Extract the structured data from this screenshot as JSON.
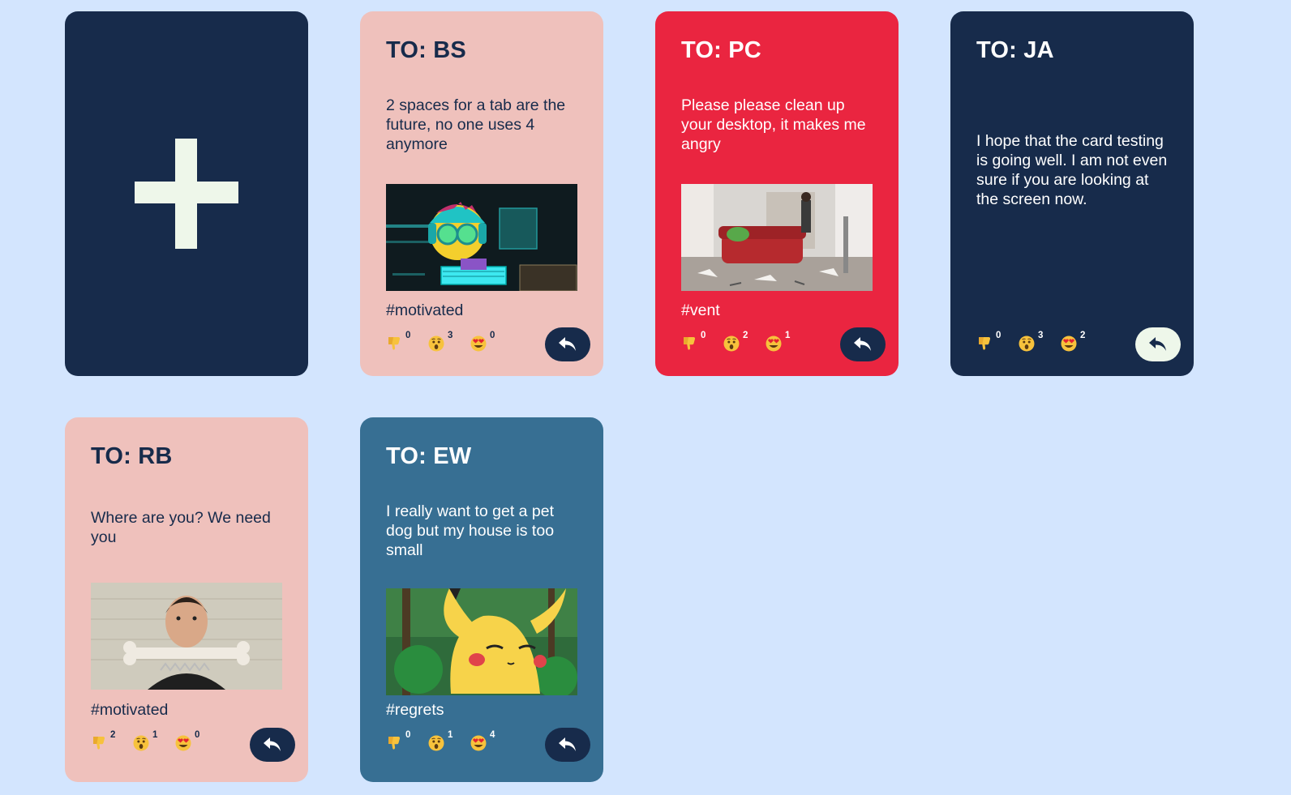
{
  "add_card": {
    "icon": "plus-icon"
  },
  "cards": [
    {
      "to": "TO: BS",
      "message": "2 spaces for a tab are the future, no one uses 4 anymore",
      "tag": "#motivated",
      "reactions": {
        "thumbs_down": "0",
        "surprised": "3",
        "heart_eyes": "0"
      },
      "gif": "cartoon-hacker-gif"
    },
    {
      "to": "TO: PC",
      "message": "Please please clean up your desktop, it makes me angry",
      "tag": "#vent",
      "reactions": {
        "thumbs_down": "0",
        "surprised": "2",
        "heart_eyes": "1"
      },
      "gif": "messy-room-gif"
    },
    {
      "to": "TO: JA",
      "message": "I hope that the card testing is going well. I am not even sure if you are looking at the screen now.",
      "reactions": {
        "thumbs_down": "0",
        "surprised": "3",
        "heart_eyes": "2"
      }
    },
    {
      "to": "TO: RB",
      "message": "Where are you? We need you",
      "tag": "#motivated",
      "reactions": {
        "thumbs_down": "2",
        "surprised": "1",
        "heart_eyes": "0"
      },
      "gif": "man-with-bone-gif"
    },
    {
      "to": "TO: EW",
      "message": "I really want to get a pet dog but my house is too small",
      "tag": "#regrets",
      "reactions": {
        "thumbs_down": "0",
        "surprised": "1",
        "heart_eyes": "4"
      },
      "gif": "sad-pikachu-gif"
    }
  ],
  "icons": {
    "reply": "reply-arrow-icon",
    "thumbs_down": "thumbs-down-icon",
    "surprised": "surprised-face-icon",
    "heart_eyes": "heart-eyes-icon"
  },
  "colors": {
    "background": "#d3e5fe",
    "navy": "#172b4b",
    "pink": "#efc1bc",
    "red": "#ea2540",
    "teal": "#376f93",
    "cream": "#eef7ea"
  }
}
